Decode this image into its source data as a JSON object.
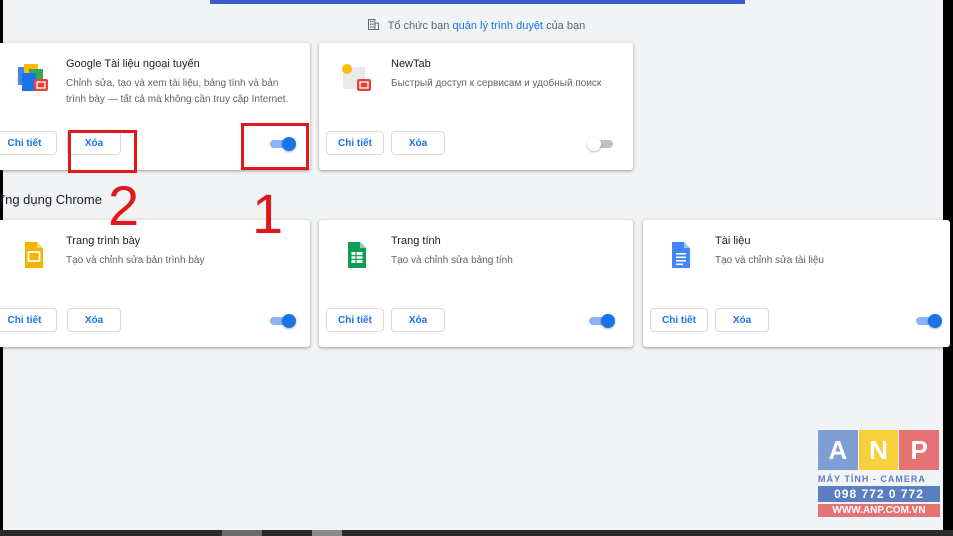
{
  "managed_notice": {
    "prefix": "Tổ chức bạn",
    "link": "quản lý trình duyệt",
    "suffix": "của bạn"
  },
  "extensions": [
    {
      "title": "Google Tài liệu ngoại tuyến",
      "description": "Chỉnh sửa, tạo và xem tài liệu, bảng tính và bản trình bày — tất cả mà không cần truy cập Internet.",
      "details_label": "Chi tiết",
      "remove_label": "Xóa",
      "enabled": true
    },
    {
      "title": "NewTab",
      "description": "Быстрый доступ к сервисам и удобный поиск",
      "details_label": "Chi tiết",
      "remove_label": "Xóa",
      "enabled": false
    }
  ],
  "section_title": "Ứng dụng Chrome",
  "apps": [
    {
      "title": "Trang trình bày",
      "description": "Tạo và chỉnh sửa bản trình bày",
      "details_label": "Chi tiết",
      "remove_label": "Xóa",
      "enabled": true,
      "icon": "slides-icon"
    },
    {
      "title": "Trang tính",
      "description": "Tạo và chỉnh sửa bảng tính",
      "details_label": "Chi tiết",
      "remove_label": "Xóa",
      "enabled": true,
      "icon": "sheets-icon"
    },
    {
      "title": "Tài liệu",
      "description": "Tạo và chỉnh sửa tài liệu",
      "details_label": "Chi tiết",
      "remove_label": "Xóa",
      "enabled": true,
      "icon": "docs-icon"
    }
  ],
  "annotations": {
    "number_1": "1",
    "number_2": "2"
  },
  "watermark": {
    "letters": [
      "A",
      "N",
      "P"
    ],
    "tagline": "MÁY TÍNH - CAMERA",
    "phone": "098 772 0 772",
    "website": "WWW.ANP.COM.VN"
  },
  "colors": {
    "accent": "#1a73e8",
    "annotation": "#e0171b",
    "background": "#f1f3f4"
  }
}
